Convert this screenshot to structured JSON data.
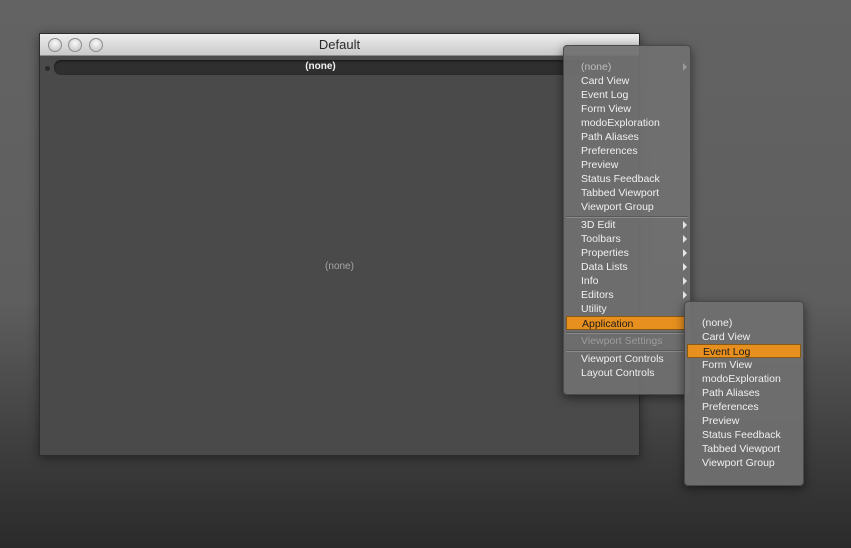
{
  "window": {
    "title": "Default",
    "header_label": "(none)",
    "center_label": "(none)"
  },
  "menu1": {
    "items": [
      {
        "label": "(none)",
        "arrow": true
      },
      {
        "label": "Card View"
      },
      {
        "label": "Event Log"
      },
      {
        "label": "Form View"
      },
      {
        "label": "modoExploration"
      },
      {
        "label": "Path Aliases"
      },
      {
        "label": "Preferences"
      },
      {
        "label": "Preview"
      },
      {
        "label": "Status Feedback"
      },
      {
        "label": "Tabbed Viewport"
      },
      {
        "label": "Viewport Group"
      },
      {
        "label": "3D Edit",
        "arrow": true
      },
      {
        "label": "Toolbars",
        "arrow": true
      },
      {
        "label": "Properties",
        "arrow": true
      },
      {
        "label": "Data Lists",
        "arrow": true
      },
      {
        "label": "Info",
        "arrow": true
      },
      {
        "label": "Editors",
        "arrow": true
      },
      {
        "label": "Utility"
      },
      {
        "label": "Application",
        "highlighted": true
      },
      {
        "label": "Viewport Settings",
        "disabled": true
      },
      {
        "label": "Viewport Controls"
      },
      {
        "label": "Layout Controls"
      }
    ]
  },
  "menu2": {
    "items": [
      {
        "label": "(none)"
      },
      {
        "label": "Card View"
      },
      {
        "label": "Event Log",
        "highlighted": true
      },
      {
        "label": "Form View"
      },
      {
        "label": "modoExploration"
      },
      {
        "label": "Path Aliases"
      },
      {
        "label": "Preferences"
      },
      {
        "label": "Preview"
      },
      {
        "label": "Status Feedback"
      },
      {
        "label": "Tabbed Viewport"
      },
      {
        "label": "Viewport Group"
      }
    ]
  },
  "colors": {
    "highlight": "#e8901f",
    "menu_bg": "#707070",
    "window_bg": "#4a4a4a"
  }
}
